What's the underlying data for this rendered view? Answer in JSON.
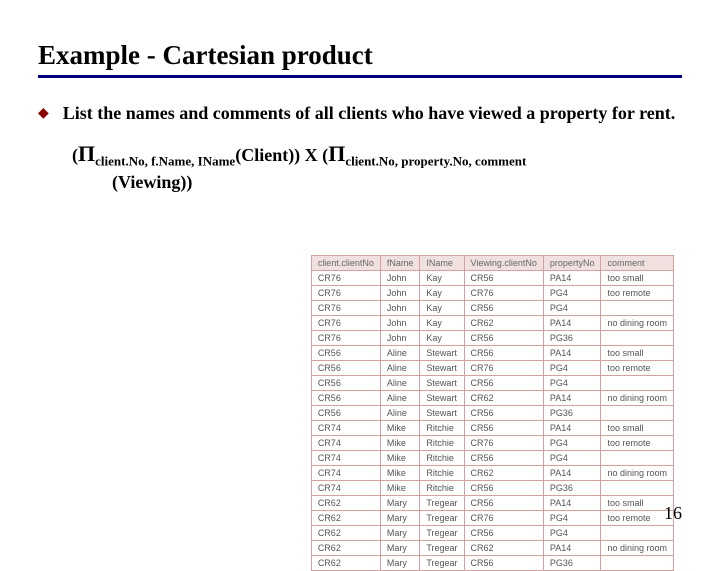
{
  "title": "Example - Cartesian product",
  "bullet": "List the names and comments of all clients who have viewed a property for rent.",
  "formula": {
    "pi": "Π",
    "sub1": "client.No, f.Name, IName",
    "arg1": "(Client)) X (",
    "sub2": "client.No, property.No, comment",
    "line2": "(Viewing))"
  },
  "page": "16",
  "columns": [
    "client.clientNo",
    "fName",
    "IName",
    "Viewing.clientNo",
    "propertyNo",
    "comment"
  ],
  "rows": [
    [
      "CR76",
      "John",
      "Kay",
      "CR56",
      "PA14",
      "too small"
    ],
    [
      "CR76",
      "John",
      "Kay",
      "CR76",
      "PG4",
      "too remote"
    ],
    [
      "CR76",
      "John",
      "Kay",
      "CR56",
      "PG4",
      ""
    ],
    [
      "CR76",
      "John",
      "Kay",
      "CR62",
      "PA14",
      "no dining room"
    ],
    [
      "CR76",
      "John",
      "Kay",
      "CR56",
      "PG36",
      ""
    ],
    [
      "CR56",
      "Aline",
      "Stewart",
      "CR56",
      "PA14",
      "too small"
    ],
    [
      "CR56",
      "Aline",
      "Stewart",
      "CR76",
      "PG4",
      "too remote"
    ],
    [
      "CR56",
      "Aline",
      "Stewart",
      "CR56",
      "PG4",
      ""
    ],
    [
      "CR56",
      "Aline",
      "Stewart",
      "CR62",
      "PA14",
      "no dining room"
    ],
    [
      "CR56",
      "Aline",
      "Stewart",
      "CR56",
      "PG36",
      ""
    ],
    [
      "CR74",
      "Mike",
      "Ritchie",
      "CR56",
      "PA14",
      "too small"
    ],
    [
      "CR74",
      "Mike",
      "Ritchie",
      "CR76",
      "PG4",
      "too remote"
    ],
    [
      "CR74",
      "Mike",
      "Ritchie",
      "CR56",
      "PG4",
      ""
    ],
    [
      "CR74",
      "Mike",
      "Ritchie",
      "CR62",
      "PA14",
      "no dining room"
    ],
    [
      "CR74",
      "Mike",
      "Ritchie",
      "CR56",
      "PG36",
      ""
    ],
    [
      "CR62",
      "Mary",
      "Tregear",
      "CR56",
      "PA14",
      "too small"
    ],
    [
      "CR62",
      "Mary",
      "Tregear",
      "CR76",
      "PG4",
      "too remote"
    ],
    [
      "CR62",
      "Mary",
      "Tregear",
      "CR56",
      "PG4",
      ""
    ],
    [
      "CR62",
      "Mary",
      "Tregear",
      "CR62",
      "PA14",
      "no dining room"
    ],
    [
      "CR62",
      "Mary",
      "Tregear",
      "CR56",
      "PG36",
      ""
    ]
  ]
}
